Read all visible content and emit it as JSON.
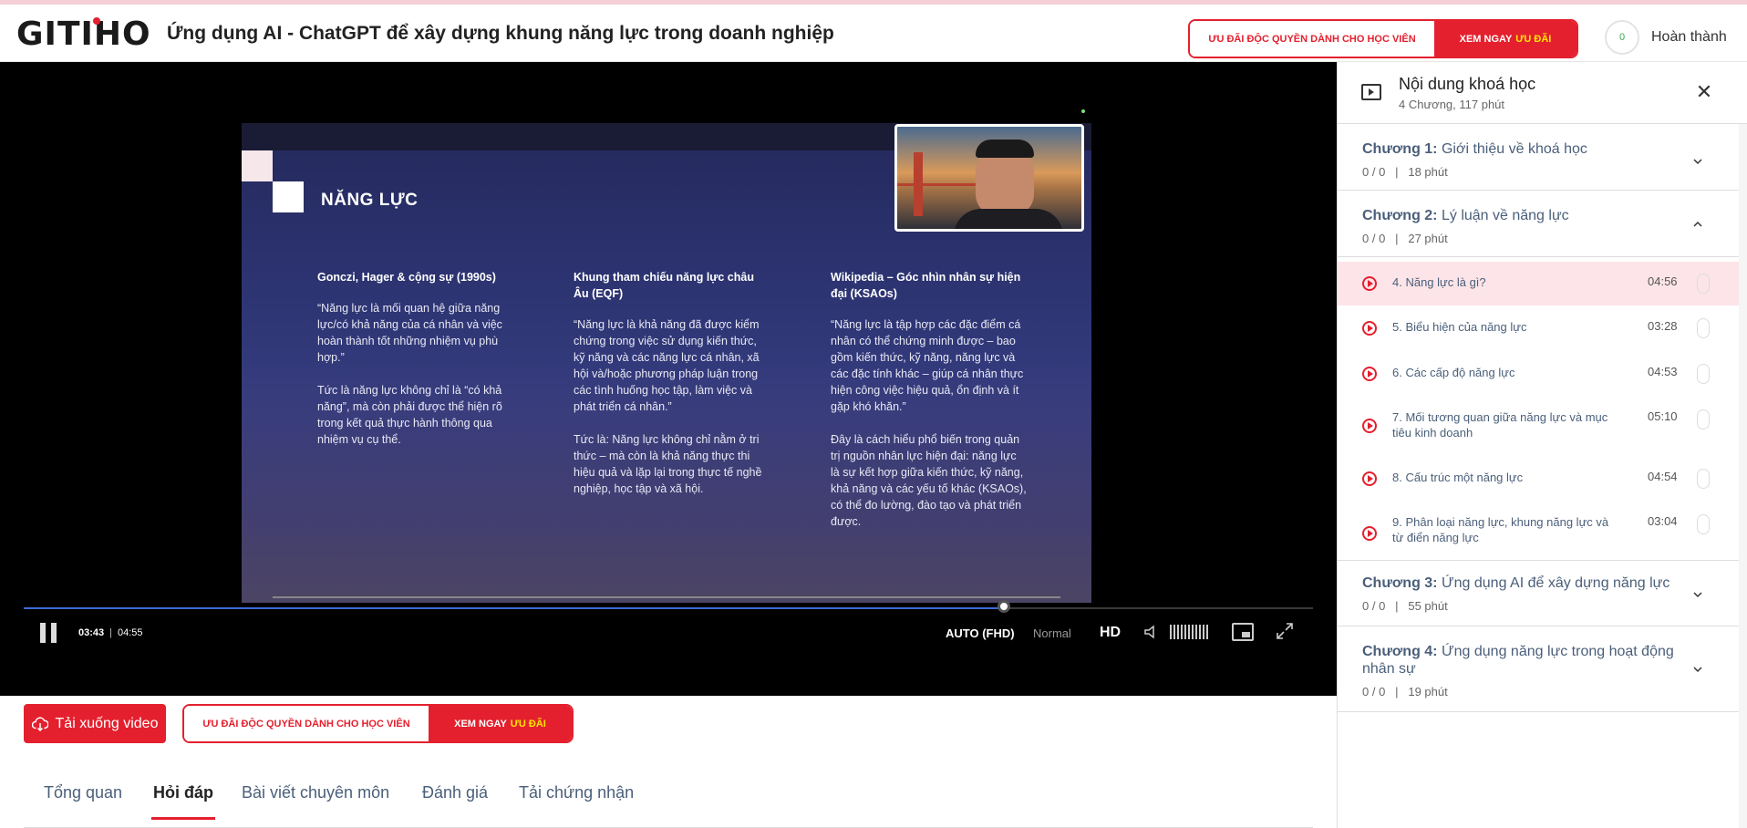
{
  "app": {
    "logo": "GITIHO",
    "course_title": "Ứng dụng AI - ChatGPT để xây dựng khung năng lực trong doanh nghiệp",
    "promo_left": "ƯU ĐÃI ĐỘC QUYỀN DÀNH CHO HỌC VIÊN",
    "promo_right_a": "XEM NGAY",
    "promo_right_b": "ƯU ĐÃI",
    "progress": "0",
    "done_label": "Hoàn thành"
  },
  "slide": {
    "heading": "NĂNG LỰC",
    "columns": [
      {
        "title": "Gonczi, Hager & cộng sự (1990s)",
        "p1": "“Năng lực là mối quan hệ giữa năng lực/có khả năng của cá nhân và việc hoàn thành tốt những nhiệm vụ phù hợp.”",
        "p2": "Tức là năng lực không chỉ là “có khả năng”, mà còn phải được thể hiện rõ trong kết quả thực hành thông qua nhiệm vụ cụ thể."
      },
      {
        "title": "Khung tham chiếu năng lực châu Âu (EQF)",
        "p1": "“Năng lực là khả năng đã được kiểm chứng trong việc sử dụng kiến thức, kỹ năng và các năng lực cá nhân, xã hội và/hoặc phương pháp luận trong các tình huống học tập, làm việc và phát triển cá nhân.”",
        "p2": "Tức là: Năng lực không chỉ nằm ở tri thức – mà còn là khả năng thực thi hiệu quả và lặp lại trong thực tế nghề nghiệp, học tập và xã hội."
      },
      {
        "title": "Wikipedia – Góc nhìn nhân sự hiện đại (KSAOs)",
        "p1": "“Năng lực là tập hợp các đặc điểm cá nhân có thể chứng minh được – bao gồm kiến thức, kỹ năng, năng lực và các đặc tính khác – giúp cá nhân thực hiện công việc hiệu quả, ổn định và ít gặp khó khăn.”",
        "p2": "Đây là cách hiểu phổ biến trong quản trị nguồn nhân lực hiện đại: năng lực là sự kết hợp giữa kiến thức, kỹ năng, khả năng và các yếu tố khác (KSAOs), có thể đo lường, đào tạo và phát triển được."
      }
    ]
  },
  "player": {
    "current": "03:43",
    "sep": "|",
    "duration": "04:55",
    "progress_fraction": 0.76,
    "quality": "AUTO (FHD)",
    "speed": "Normal",
    "hd": "HD"
  },
  "below": {
    "download": "Tải xuống video",
    "tabs": [
      "Tổng quan",
      "Hỏi đáp",
      "Bài viết chuyên môn",
      "Đánh giá",
      "Tải chứng nhận"
    ],
    "active_tab": 1
  },
  "sidebar": {
    "title": "Nội dung khoá học",
    "subtitle": "4 Chương, 117 phút",
    "chapters": [
      {
        "label": "Chương 1:",
        "name": "Giới thiệu về khoá học",
        "meta": "0 / 0   |   18 phút"
      },
      {
        "label": "Chương 2:",
        "name": "Lý luận về năng lực",
        "meta": "0 / 0   |   27 phút"
      },
      {
        "label": "Chương 3:",
        "name": "Ứng dụng AI để xây dựng năng lực",
        "meta": "0 / 0   |   55 phút"
      },
      {
        "label": "Chương 4:",
        "name": "Ứng dụng năng lực trong hoạt động nhân sự",
        "meta": "0 / 0   |   19 phút"
      }
    ],
    "lessons": [
      {
        "title": "4. Năng lực là gì?",
        "dur": "04:56"
      },
      {
        "title": "5. Biểu hiện của năng lực",
        "dur": "03:28"
      },
      {
        "title": "6. Các cấp độ năng lực",
        "dur": "04:53"
      },
      {
        "title": "7. Mối tương quan giữa năng lực và mục tiêu kinh doanh",
        "dur": "05:10"
      },
      {
        "title": "8. Cấu trúc một năng lực",
        "dur": "04:54"
      },
      {
        "title": "9. Phân loại năng lực, khung năng lực và từ điển năng lực",
        "dur": "03:04"
      }
    ]
  }
}
